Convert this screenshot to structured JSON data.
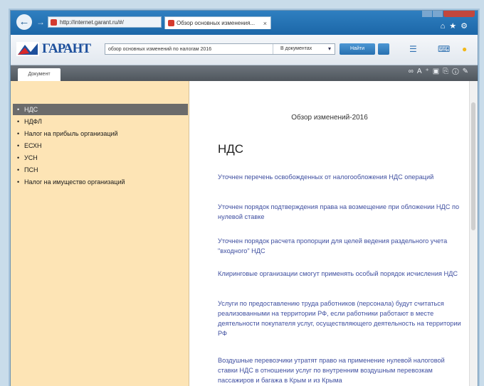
{
  "browser": {
    "address_text": "http://internet.garant.ru/#/",
    "tab_title": "Обзор основных изменения..."
  },
  "toolbar": {
    "logo_text": "ГАРАНТ",
    "search_value": "обзор основных изменений по налогам 2016",
    "scope": "В документах",
    "find_label": "Найти"
  },
  "docbar": {
    "tab_label": "Документ"
  },
  "sidebar": {
    "items": [
      {
        "label": "НДС"
      },
      {
        "label": "НДФЛ"
      },
      {
        "label": "Налог на прибыль организаций"
      },
      {
        "label": "ЕСХН"
      },
      {
        "label": "УСН"
      },
      {
        "label": "ПСН"
      },
      {
        "label": "Налог на имущество организаций"
      }
    ]
  },
  "main": {
    "doc_title": "Обзор изменений-2016",
    "section_heading": "НДС",
    "links": [
      {
        "text": "Уточнен перечень освобожденных от налогообложения НДС операций"
      },
      {
        "text": "Уточнен порядок подтверждения права на возмещение при обложении НДС по нулевой ставке"
      },
      {
        "text": "Уточнен порядок расчета пропорции для целей ведения раздельного учета \"входного\" НДС"
      },
      {
        "text": "Клиринговые организации смогут применять особый порядок исчисления НДС"
      },
      {
        "text": "Услуги по предоставлению труда работников (персонала) будут считаться реализованными на территории РФ, если работники работают в месте деятельности покупателя услуг, осуществляющего деятельность на территории РФ"
      },
      {
        "text": "Воздушные перевозчики утратят право на применение нулевой налоговой ставки НДС в отношении услуг по внутренним воздушным перевозкам пассажиров и багажа в Крым и из Крыма"
      }
    ]
  },
  "colors": {
    "titlebar": "#1c67a8",
    "sidebar_bg": "#fde4b5",
    "selected_item": "#6b6b6b",
    "link": "#3f4fa0"
  }
}
